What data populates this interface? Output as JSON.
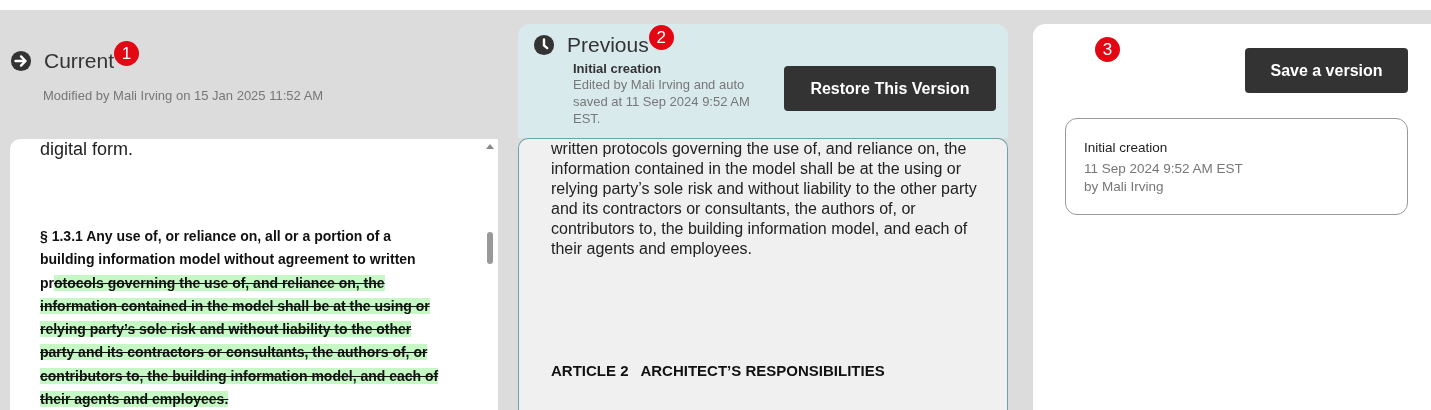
{
  "current": {
    "title": "Current",
    "badge": "1",
    "meta": "Modified by Mali Irving on 15 Jan 2025 11:52 AM",
    "document": [
      {
        "kind": "text",
        "text": "digital form."
      },
      {
        "kind": "clause",
        "segments": [
          {
            "kind": "plain",
            "text": "§ 1.3.1 Any use of, or reliance on, all or a portion of a building information model without agreement to written pr"
          },
          {
            "kind": "deleted",
            "text": "otocols governing the use of, and reliance on, the information contained in the model shall be at the using or relying party’s sole risk and without liability to the other party and its contractors or consultants, the authors of, or contributors to, the building information model, and each of their agents and employees."
          }
        ]
      }
    ]
  },
  "previous": {
    "title": "Previous",
    "badge": "2",
    "version_name": "Initial creation",
    "details": "Edited by Mali Irving and auto saved at 11 Sep 2024 9:52 AM EST.",
    "restore_button": "Restore This Version",
    "document": [
      {
        "kind": "text",
        "text": "written protocols governing the use of, and reliance on, the information contained in the model shall be at the using or relying party’s sole risk and without liability to the other party and its contractors or consultants, the authors of, or contributors to, the building information model, and each of their agents and employees."
      },
      {
        "kind": "heading",
        "text": "ARTICLE 2   ARCHITECT’S RESPONSIBILITIES"
      }
    ]
  },
  "versions": {
    "badge": "3",
    "save_button": "Save a version",
    "items": [
      {
        "name": "Initial creation",
        "date": "11 Sep 2024 9:52 AM EST",
        "author": "by Mali Irving"
      }
    ]
  }
}
